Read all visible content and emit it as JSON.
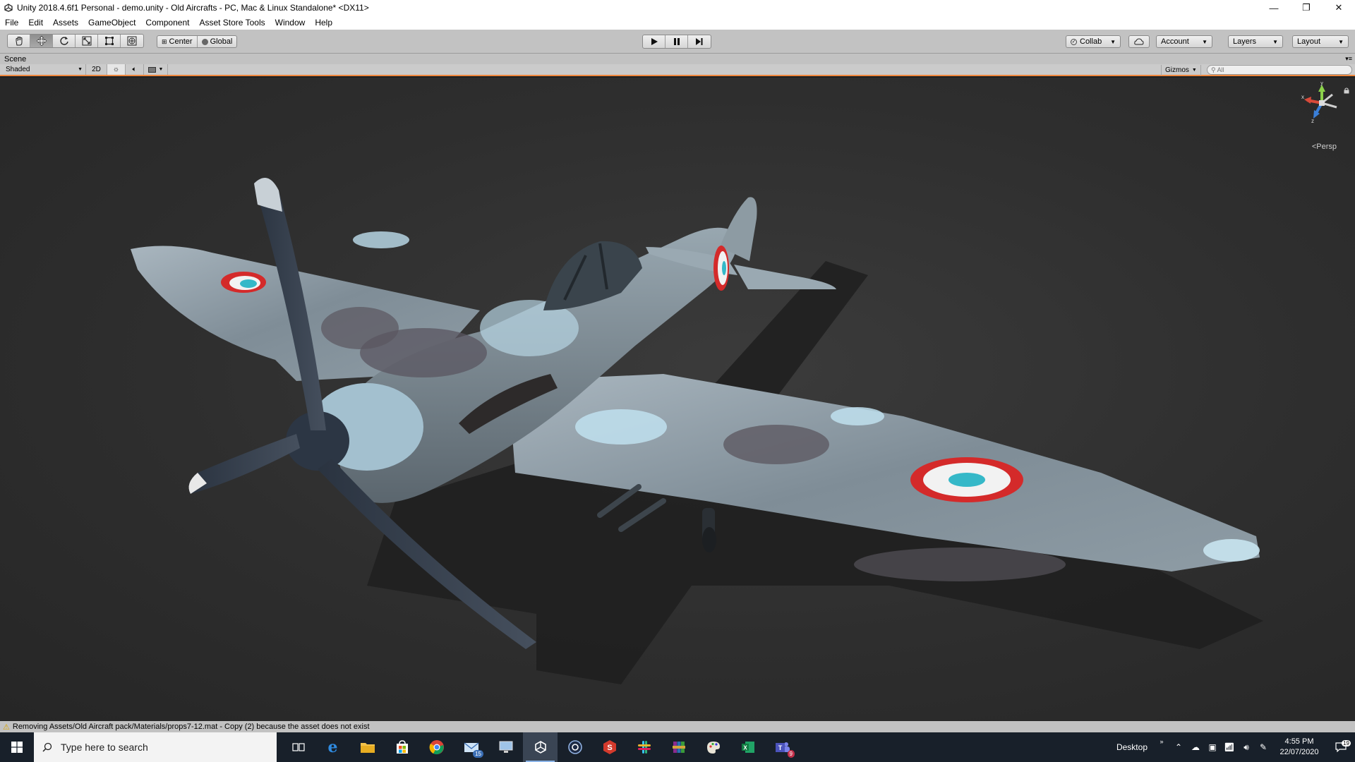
{
  "window": {
    "title": "Unity 2018.4.6f1 Personal - demo.unity - Old Aircrafts - PC, Mac & Linux Standalone* <DX11>",
    "controls": {
      "minimize": "—",
      "restore": "❐",
      "close": "✕"
    }
  },
  "menu": [
    "File",
    "Edit",
    "Assets",
    "GameObject",
    "Component",
    "Asset Store Tools",
    "Window",
    "Help"
  ],
  "toolbar": {
    "tools": [
      "hand-tool",
      "move-tool",
      "rotate-tool",
      "scale-tool",
      "rect-tool",
      "transform-tool"
    ],
    "active_tool": "move-tool",
    "pivot_mode": "Center",
    "pivot_rotation": "Global",
    "collab": "Collab",
    "account": "Account",
    "layers": "Layers",
    "layout": "Layout"
  },
  "scene": {
    "tab_label": "Scene",
    "draw_mode": "Shaded",
    "mode_2d": "2D",
    "gizmos": "Gizmos",
    "search_placeholder": "All",
    "projection": "Persp",
    "axes": {
      "x": "x",
      "y": "y",
      "z": "z"
    },
    "roundel_colors": {
      "outer": "#d42a2a",
      "middle": "#f2f2f2",
      "inner": "#35b8c8"
    }
  },
  "status": {
    "message": "Removing Assets/Old Aircraft pack/Materials/props7-12.mat - Copy (2) because the asset does not exist"
  },
  "taskbar": {
    "search_placeholder": "Type here to search",
    "mail_badge": "15",
    "teams_badge": "9",
    "desktop_label": "Desktop",
    "time": "4:55 PM",
    "date": "22/07/2020",
    "notifications": "19"
  }
}
